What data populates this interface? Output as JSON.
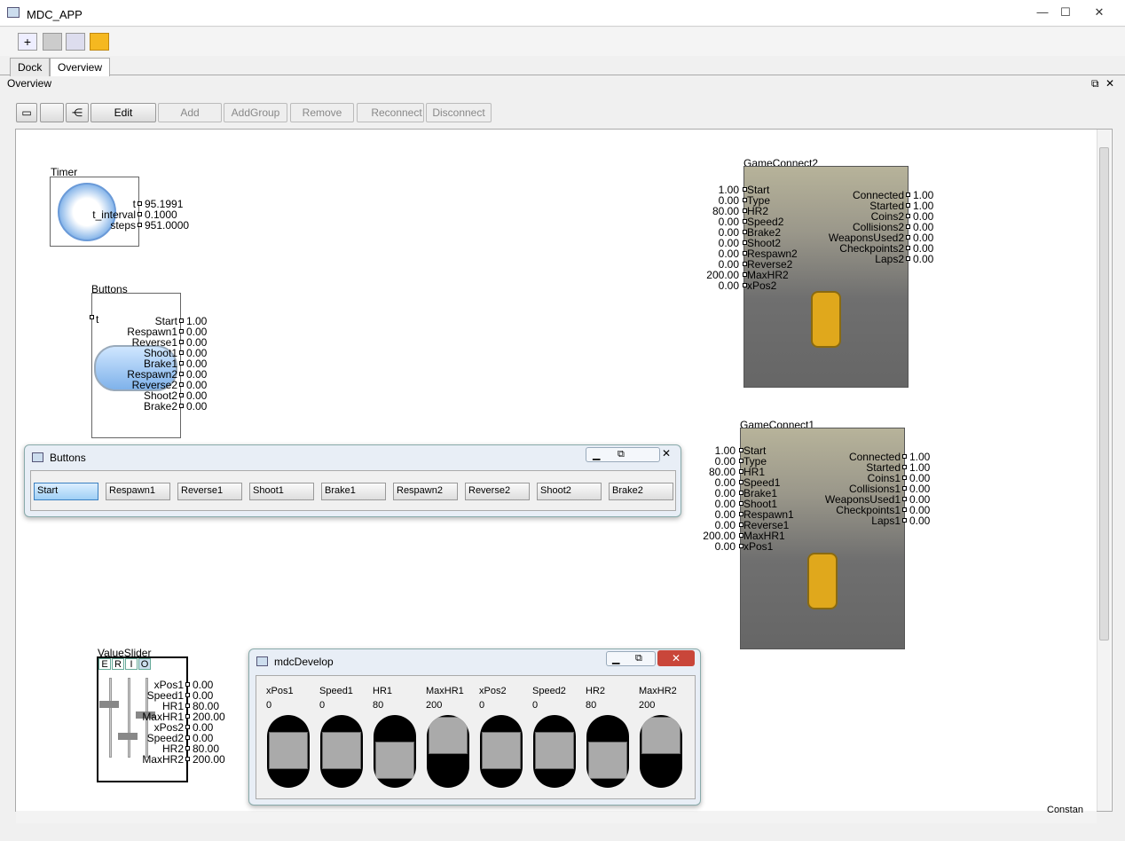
{
  "window": {
    "title": "MDC_APP",
    "min": "—",
    "max": "☐",
    "close": "✕"
  },
  "tabs": [
    "Dock",
    "Overview"
  ],
  "panel_title": "Overview",
  "toolbar": {
    "edit": "Edit",
    "add": "Add",
    "addgroup": "AddGroup",
    "remove": "Remove",
    "reconnect": "Reconnect",
    "disconnect": "Disconnect"
  },
  "timer": {
    "title": "Timer",
    "ports": [
      {
        "label": "t",
        "value": "95.1991"
      },
      {
        "label": "t_interval",
        "value": "0.1000"
      },
      {
        "label": "steps",
        "value": "951.0000"
      }
    ]
  },
  "buttons_node": {
    "title": "Buttons",
    "input": "t",
    "ports": [
      {
        "label": "Start",
        "value": "1.00"
      },
      {
        "label": "Respawn1",
        "value": "0.00"
      },
      {
        "label": "Reverse1",
        "value": "0.00"
      },
      {
        "label": "Shoot1",
        "value": "0.00"
      },
      {
        "label": "Brake1",
        "value": "0.00"
      },
      {
        "label": "Respawn2",
        "value": "0.00"
      },
      {
        "label": "Reverse2",
        "value": "0.00"
      },
      {
        "label": "Shoot2",
        "value": "0.00"
      },
      {
        "label": "Brake2",
        "value": "0.00"
      }
    ]
  },
  "buttons_window": {
    "title": "Buttons",
    "buttons": [
      "Start",
      "Respawn1",
      "Reverse1",
      "Shoot1",
      "Brake1",
      "Respawn2",
      "Reverse2",
      "Shoot2",
      "Brake2"
    ]
  },
  "gc2": {
    "title": "GameConnect2",
    "inputs": [
      {
        "label": "Start",
        "value": "1.00"
      },
      {
        "label": "Type",
        "value": "0.00"
      },
      {
        "label": "HR2",
        "value": "80.00"
      },
      {
        "label": "Speed2",
        "value": "0.00"
      },
      {
        "label": "Brake2",
        "value": "0.00"
      },
      {
        "label": "Shoot2",
        "value": "0.00"
      },
      {
        "label": "Respawn2",
        "value": "0.00"
      },
      {
        "label": "Reverse2",
        "value": "0.00"
      },
      {
        "label": "MaxHR2",
        "value": "200.00"
      },
      {
        "label": "xPos2",
        "value": "0.00"
      }
    ],
    "outputs": [
      {
        "label": "Connected",
        "value": "1.00"
      },
      {
        "label": "Started",
        "value": "1.00"
      },
      {
        "label": "Coins2",
        "value": "0.00"
      },
      {
        "label": "Collisions2",
        "value": "0.00"
      },
      {
        "label": "WeaponsUsed2",
        "value": "0.00"
      },
      {
        "label": "Checkpoints2",
        "value": "0.00"
      },
      {
        "label": "Laps2",
        "value": "0.00"
      }
    ]
  },
  "gc1": {
    "title": "GameConnect1",
    "inputs": [
      {
        "label": "Start",
        "value": "1.00"
      },
      {
        "label": "Type",
        "value": "0.00"
      },
      {
        "label": "HR1",
        "value": "80.00"
      },
      {
        "label": "Speed1",
        "value": "0.00"
      },
      {
        "label": "Brake1",
        "value": "0.00"
      },
      {
        "label": "Shoot1",
        "value": "0.00"
      },
      {
        "label": "Respawn1",
        "value": "0.00"
      },
      {
        "label": "Reverse1",
        "value": "0.00"
      },
      {
        "label": "MaxHR1",
        "value": "200.00"
      },
      {
        "label": "xPos1",
        "value": "0.00"
      }
    ],
    "outputs": [
      {
        "label": "Connected",
        "value": "1.00"
      },
      {
        "label": "Started",
        "value": "1.00"
      },
      {
        "label": "Coins1",
        "value": "0.00"
      },
      {
        "label": "Collisions1",
        "value": "0.00"
      },
      {
        "label": "WeaponsUsed1",
        "value": "0.00"
      },
      {
        "label": "Checkpoints1",
        "value": "0.00"
      },
      {
        "label": "Laps1",
        "value": "0.00"
      }
    ]
  },
  "value_slider": {
    "title": "ValueSlider",
    "tabs": [
      "E",
      "R",
      "I",
      "O"
    ],
    "ports": [
      {
        "label": "xPos1",
        "value": "0.00"
      },
      {
        "label": "Speed1",
        "value": "0.00"
      },
      {
        "label": "HR1",
        "value": "80.00"
      },
      {
        "label": "MaxHR1",
        "value": "200.00"
      },
      {
        "label": "xPos2",
        "value": "0.00"
      },
      {
        "label": "Speed2",
        "value": "0.00"
      },
      {
        "label": "HR2",
        "value": "80.00"
      },
      {
        "label": "MaxHR2",
        "value": "200.00"
      }
    ]
  },
  "mdc_develop": {
    "title": "mdcDevelop",
    "sliders": [
      {
        "label": "xPos1",
        "value": "0",
        "level": 0.5
      },
      {
        "label": "Speed1",
        "value": "0",
        "level": 0.5
      },
      {
        "label": "HR1",
        "value": "80",
        "level": 0.2
      },
      {
        "label": "MaxHR1",
        "value": "200",
        "level": 0.95
      },
      {
        "label": "xPos2",
        "value": "0",
        "level": 0.5
      },
      {
        "label": "Speed2",
        "value": "0",
        "level": 0.5
      },
      {
        "label": "HR2",
        "value": "80",
        "level": 0.2
      },
      {
        "label": "MaxHR2",
        "value": "200",
        "level": 0.95
      }
    ]
  },
  "corner_text": "Constan"
}
